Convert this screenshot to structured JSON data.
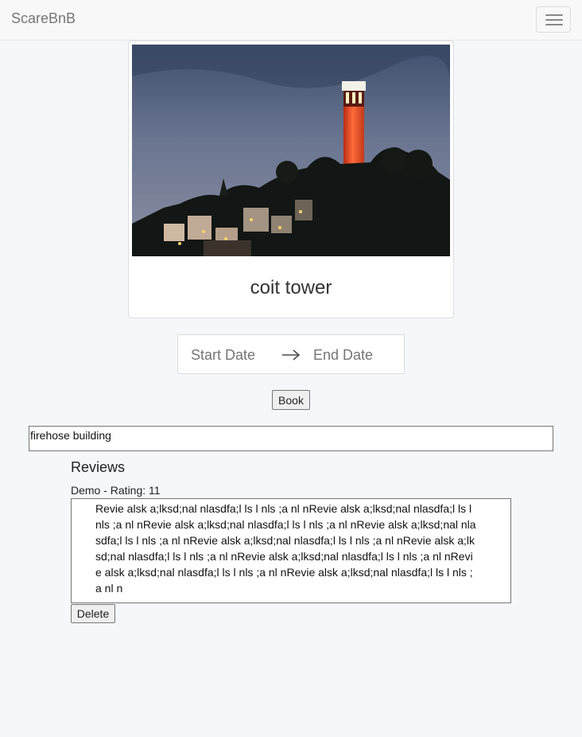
{
  "navbar": {
    "brand": "ScareBnB",
    "menu_icon": "hamburger-icon"
  },
  "listing": {
    "title": "coit tower",
    "photo_alt": "coit tower"
  },
  "booking": {
    "start_placeholder": "Start Date",
    "end_placeholder": "End Date",
    "arrow_icon": "arrow-right-icon",
    "book_label": "Book"
  },
  "description": "firehose building",
  "reviews": {
    "heading": "Reviews",
    "items": [
      {
        "meta": "Demo - Rating: 11",
        "body": "Revie alsk a;lksd;nal nlasdfa;l ls l nls ;a nl nRevie alsk a;lksd;nal nlasdfa;l ls l nls ;a nl nRevie alsk a;lksd;nal nlasdfa;l ls l nls ;a nl nRevie alsk a;lksd;nal nlasdfa;l ls l nls ;a nl nRevie alsk a;lksd;nal nlasdfa;l ls l nls ;a nl nRevie alsk a;lksd;nal nlasdfa;l ls l nls ;a nl nRevie alsk a;lksd;nal nlasdfa;l ls l nls ;a nl nRevie alsk a;lksd;nal nlasdfa;l ls l nls ;a nl nRevie alsk a;lksd;nal nlasdfa;l ls l nls ;a nl n",
        "delete_label": "Delete"
      }
    ]
  },
  "colors": {
    "page_background": "#f6f7fb",
    "navbar_background": "#f8f8f8",
    "brand_text": "#777777"
  }
}
